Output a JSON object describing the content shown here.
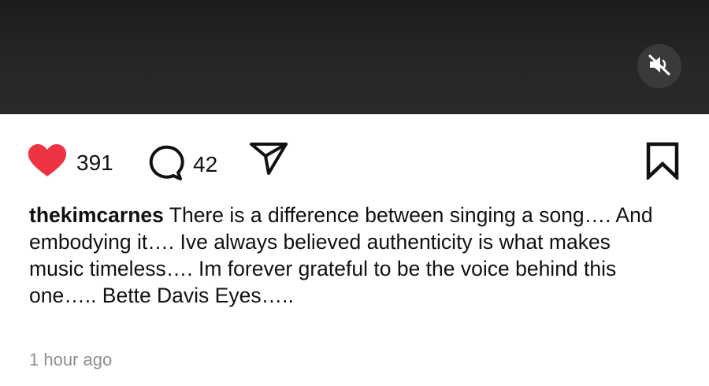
{
  "video": {
    "mute_icon": "speaker-muted-icon"
  },
  "actions": {
    "like": {
      "icon": "heart-filled-icon",
      "count": "391",
      "color": "#ee3343"
    },
    "comment": {
      "icon": "comment-bubble-icon",
      "count": "42"
    },
    "share": {
      "icon": "paper-plane-icon"
    },
    "save": {
      "icon": "bookmark-icon"
    }
  },
  "post": {
    "username": "thekimcarnes",
    "caption": "There is a difference between singing a song…. And embodying it…. Ive always believed authenticity is what makes music timeless…. Im forever grateful to be the voice behind this one….. Bette Davis Eyes…..",
    "timestamp": "1 hour ago"
  }
}
